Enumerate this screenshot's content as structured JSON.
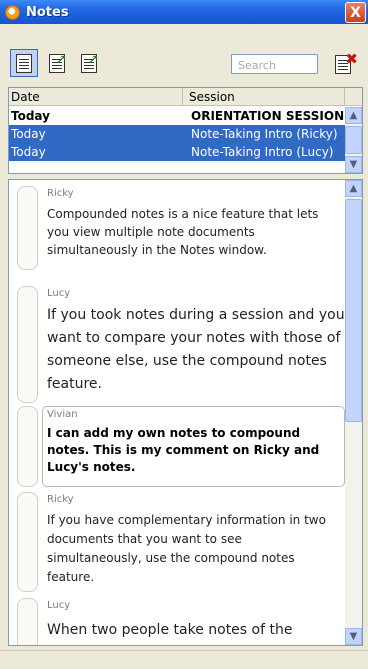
{
  "window": {
    "title": "Notes",
    "close_label": "X"
  },
  "toolbar": {
    "buttons": [
      {
        "name": "view",
        "icon": "notes-view-icon"
      },
      {
        "name": "note2",
        "icon": "export-note-icon"
      },
      {
        "name": "note3",
        "icon": "export-note-icon"
      }
    ],
    "search_placeholder": "Search",
    "delete_icon": "delete-note-icon"
  },
  "sessions": {
    "headers": [
      "Date",
      "Session"
    ],
    "rows": [
      {
        "date": "Today",
        "session": "ORIENTATION SESSION",
        "state": "bold"
      },
      {
        "date": "Today",
        "session": "Note-Taking Intro (Ricky)",
        "state": "selected"
      },
      {
        "date": "Today",
        "session": "Note-Taking Intro (Lucy)",
        "state": "selected"
      }
    ]
  },
  "notes": [
    {
      "author": "Ricky",
      "text": "Compounded notes is a nice feature that lets you view multiple note documents simultaneously in the Notes window."
    },
    {
      "author": "Lucy",
      "text": "If you took notes during a session and you want to compare your notes with those of someone else, use the compound notes feature."
    },
    {
      "author": "Vivian",
      "text": "I can add my own notes to compound notes. This is my comment on Ricky and Lucy's notes."
    },
    {
      "author": "Ricky",
      "text": "If you have complementary information in two documents that you want to see simultaneously, use the compound notes feature."
    },
    {
      "author": "Lucy",
      "text": "When two people take notes of the"
    }
  ],
  "colors": {
    "title_bar": "#1f66e0",
    "selection": "#316ac5",
    "scrollbar": "#c3d3fd"
  }
}
